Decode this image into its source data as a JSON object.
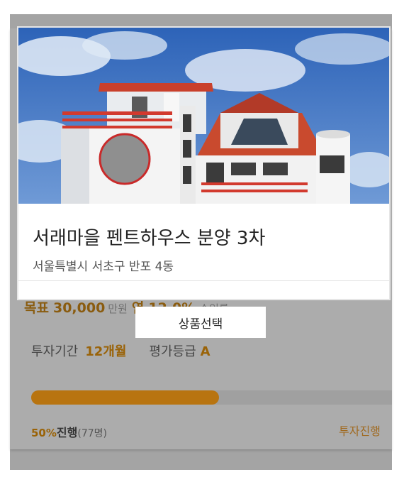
{
  "product": {
    "title": "서래마을 펜트하우스 분양 3차",
    "address": "서울특별시 서초구 반포 4동",
    "image_alt": "house-illustration"
  },
  "investment": {
    "goal_label": "목표",
    "goal_amount": "30,000",
    "goal_unit": "만원",
    "rate_label": "연",
    "rate_value": "12.0%",
    "rate_unit": "수익률",
    "period_label": "투자기간",
    "period_value": "12개월",
    "grade_label": "평가등급",
    "grade_value": "A",
    "progress_percent": 50,
    "progress_pct_text": "50%",
    "progress_word": "진행",
    "investor_count": "(77명)",
    "status_right": "투자진행"
  },
  "tooltip": {
    "text": "상품선택"
  },
  "colors": {
    "accent": "#b87410",
    "overlay": "#a4a4a4"
  }
}
